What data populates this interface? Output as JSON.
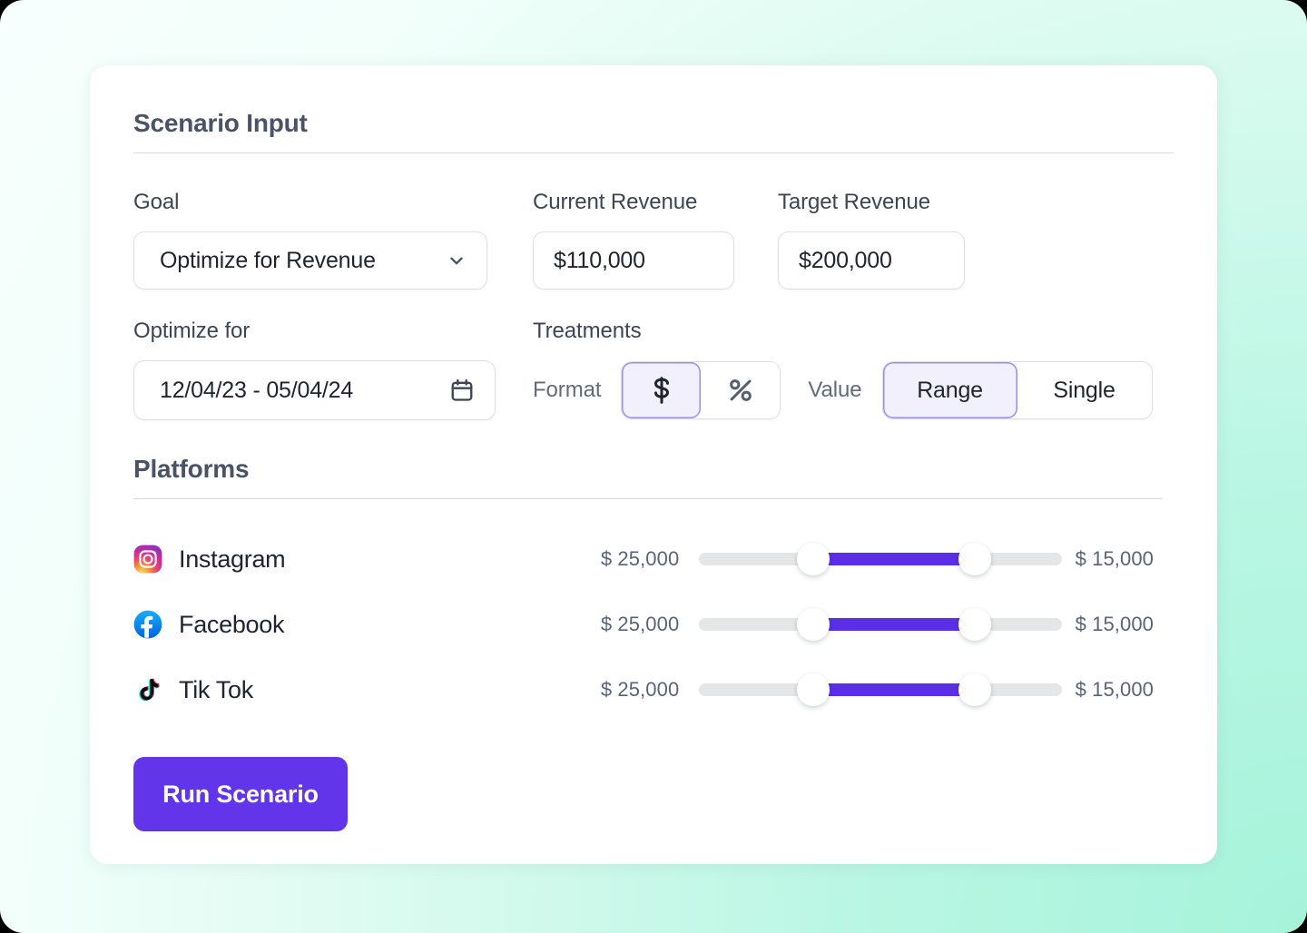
{
  "theme": {
    "accent_purple": "#5b2ee8",
    "button_purple": "#6335ea",
    "segment_active_bg": "#f3f0fe",
    "segment_active_border": "#9b8cf0",
    "track_grey": "#e4e6e8",
    "heading_slate": "#4a5366",
    "background_mint": "#b4f5e0"
  },
  "scenario": {
    "title": "Scenario Input",
    "goal": {
      "label": "Goal",
      "value": "Optimize for Revenue",
      "chevron_icon": "chevron-down-icon"
    },
    "current_revenue": {
      "label": "Current Revenue",
      "value": "$110,000"
    },
    "target_revenue": {
      "label": "Target Revenue",
      "value": "$200,000"
    },
    "optimize_for": {
      "label": "Optimize for",
      "value": "12/04/23 - 05/04/24",
      "calendar_icon": "calendar-icon"
    },
    "treatments": {
      "label": "Treatments",
      "format": {
        "label": "Format",
        "options": [
          {
            "id": "currency",
            "glyph": "dollar-icon",
            "selected": true
          },
          {
            "id": "percent",
            "glyph": "percent-icon",
            "selected": false
          }
        ]
      },
      "value": {
        "label": "Value",
        "options": [
          {
            "id": "range",
            "label": "Range",
            "selected": true
          },
          {
            "id": "single",
            "label": "Single",
            "selected": false
          }
        ]
      }
    }
  },
  "platforms": {
    "title": "Platforms",
    "rows": [
      {
        "name": "Instagram",
        "icon": "instagram-icon",
        "min_amount": "$ 25,000",
        "max_amount": "$ 15,000",
        "range_start_pct": 32,
        "range_end_pct": 77
      },
      {
        "name": "Facebook",
        "icon": "facebook-icon",
        "min_amount": "$ 25,000",
        "max_amount": "$ 15,000",
        "range_start_pct": 32,
        "range_end_pct": 77
      },
      {
        "name": "Tik Tok",
        "icon": "tiktok-icon",
        "min_amount": "$ 25,000",
        "max_amount": "$ 15,000",
        "range_start_pct": 32,
        "range_end_pct": 77
      }
    ]
  },
  "actions": {
    "run_label": "Run Scenario"
  }
}
